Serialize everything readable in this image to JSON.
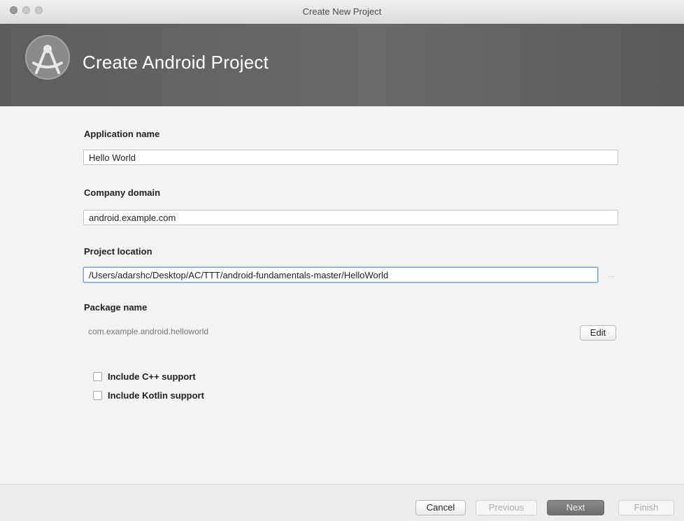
{
  "window": {
    "title": "Create New Project"
  },
  "banner": {
    "title": "Create Android Project"
  },
  "form": {
    "app_name": {
      "label": "Application name",
      "value": "Hello World"
    },
    "company_domain": {
      "label": "Company domain",
      "value": "android.example.com"
    },
    "project_location": {
      "label": "Project location",
      "value": "/Users/adarshc/Desktop/AC/TTT/android-fundamentals-master/HelloWorld",
      "browse_label": "..."
    },
    "package_name": {
      "label": "Package name",
      "value": "com.example.android.helloworld",
      "edit_label": "Edit"
    },
    "options": [
      {
        "label": "Include C++ support",
        "checked": false
      },
      {
        "label": "Include Kotlin support",
        "checked": false
      }
    ]
  },
  "footer": {
    "cancel_label": "Cancel",
    "previous_label": "Previous",
    "next_label": "Next",
    "finish_label": "Finish"
  },
  "colors": {
    "banner": "#5f5f5f",
    "accent_focus": "#7aa7e0",
    "primary_button": "#777777"
  },
  "icons": {
    "logo": "android-studio-logo-icon"
  }
}
